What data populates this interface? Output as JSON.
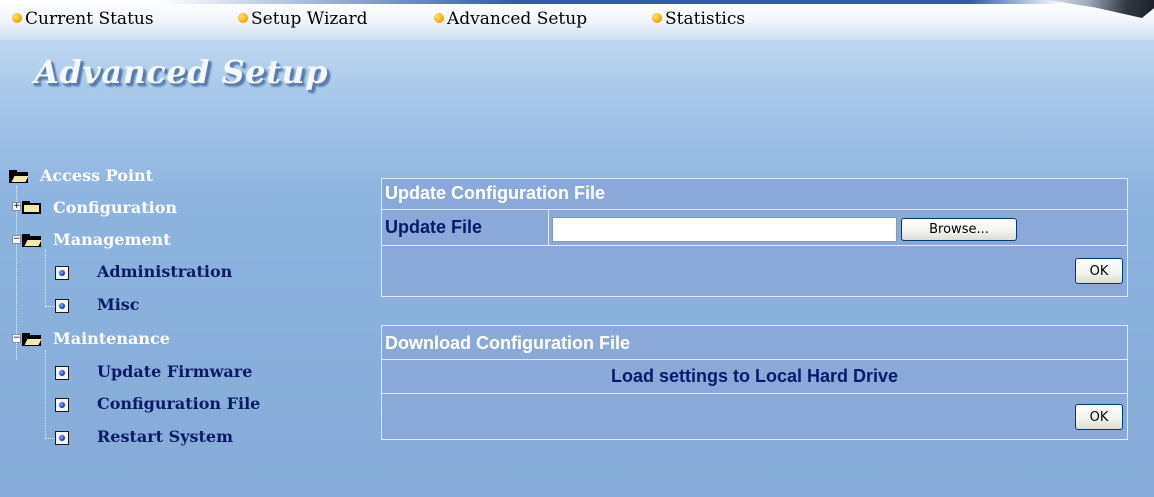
{
  "nav": {
    "items": [
      {
        "label": "Current Status"
      },
      {
        "label": "Setup Wizard"
      },
      {
        "label": "Advanced Setup"
      },
      {
        "label": "Statistics"
      }
    ]
  },
  "page": {
    "title": "Advanced Setup"
  },
  "tree": {
    "root": "Access Point",
    "configuration": "Configuration",
    "management": "Management",
    "administration": "Administration",
    "misc": "Misc",
    "maintenance": "Maintenance",
    "update_firmware": "Update Firmware",
    "configuration_file": "Configuration File",
    "restart_system": "Restart System",
    "expand_symbol": "+",
    "collapse_symbol": "−"
  },
  "update_panel": {
    "title": "Update Configuration File",
    "file_label": "Update File",
    "file_value": "",
    "browse_label": "Browse...",
    "ok_label": "OK"
  },
  "download_panel": {
    "title": "Download Configuration File",
    "description": "Load settings to Local Hard Drive",
    "ok_label": "OK"
  },
  "colors": {
    "panel_header_text": "#ffffff",
    "label_text": "#061a6a",
    "nav_bullet": "#f3b40a",
    "tree_leaf_text": "#0b1a66"
  }
}
